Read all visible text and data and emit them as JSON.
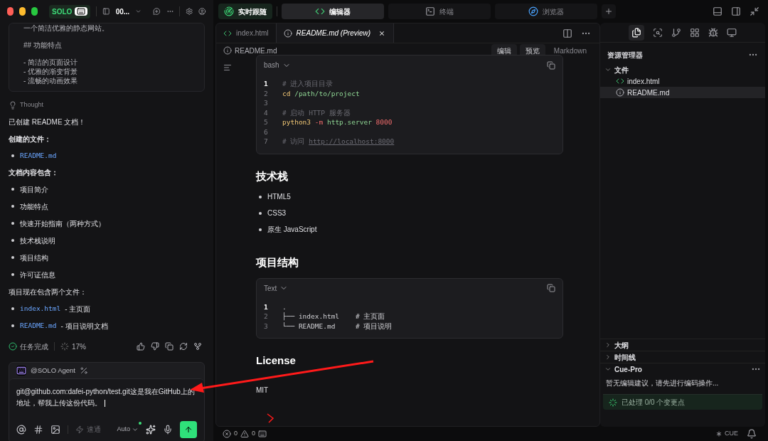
{
  "topbar": {
    "brand": "SOLO",
    "project": "00..."
  },
  "chat": {
    "snippet_groups": [
      [
        "一个简洁优雅的静态网站。"
      ],
      [
        "## 功能特点"
      ],
      [
        "- 简洁的页面设计",
        "- 优雅的渐变背景",
        "- 流畅的动画效果"
      ]
    ],
    "thought": "Thought",
    "blocks": [
      {
        "kind": "paragraph",
        "text": "已创建 README 文档！"
      },
      {
        "kind": "heading",
        "text": "创建的文件："
      },
      {
        "kind": "list",
        "items": [
          {
            "code": "README.md"
          }
        ]
      },
      {
        "kind": "heading",
        "text": "文档内容包含："
      },
      {
        "kind": "list",
        "items": [
          {
            "text": "项目简介"
          },
          {
            "text": "功能特点"
          },
          {
            "text": "快速开始指南（两种方式）"
          },
          {
            "text": "技术栈说明"
          },
          {
            "text": "项目结构"
          },
          {
            "text": "许可证信息"
          }
        ]
      },
      {
        "kind": "paragraph",
        "text": "项目现在包含两个文件："
      },
      {
        "kind": "list",
        "items": [
          {
            "code": "index.html",
            "text": "- 主页面"
          },
          {
            "code": "README.md",
            "text": "- 项目说明文档"
          }
        ]
      }
    ],
    "status": "任务完成",
    "progress": "17%",
    "input": {
      "mention": "@SOLO Agent",
      "value": "git@github.com:dafei-python/test.git这是我在GitHub上的地址，帮我上传这份代码。",
      "mode": "速通",
      "model": "Auto"
    }
  },
  "top_tabs": [
    {
      "label": "编辑器",
      "kind": "editor",
      "selected": true
    },
    {
      "label": "终端",
      "kind": "terminal",
      "selected": false
    },
    {
      "label": "浏览器",
      "kind": "browser",
      "selected": false
    }
  ],
  "follow_button": "实时跟随",
  "editor": {
    "tabs": [
      {
        "label": "index.html",
        "kind": "html",
        "selected": false
      },
      {
        "label": "README.md (Preview)",
        "kind": "info",
        "selected": true
      }
    ],
    "breadcrumb": "README.md",
    "modes": [
      "编辑",
      "预览",
      "Markdown"
    ],
    "content": [
      {
        "kind": "code",
        "lang": "bash",
        "lines": [
          {
            "num": "1",
            "active": true,
            "tokens": [
              {
                "kind": "comment",
                "text": "# 进入项目目录"
              }
            ]
          },
          {
            "num": "2",
            "active": false,
            "tokens": [
              {
                "kind": "command",
                "text": "cd"
              },
              {
                "kind": "path",
                "text": " /path/to/project"
              }
            ]
          },
          {
            "num": "3",
            "active": false
          },
          {
            "num": "4",
            "active": false,
            "tokens": [
              {
                "kind": "comment",
                "text": "# 启动 HTTP 服务器"
              }
            ]
          },
          {
            "num": "5",
            "active": false,
            "tokens": [
              {
                "kind": "command",
                "text": "python3"
              },
              {
                "kind": "flag",
                "text": " -m"
              },
              {
                "kind": "path",
                "text": " http.server"
              },
              {
                "kind": "number",
                "text": " 8000"
              }
            ]
          },
          {
            "num": "6",
            "active": false
          },
          {
            "num": "7",
            "active": false,
            "tokens": [
              {
                "kind": "comment",
                "text": "# 访问 "
              },
              {
                "kind": "link",
                "text": "http://localhost:8000"
              }
            ]
          }
        ]
      },
      {
        "kind": "heading",
        "text": "技术栈"
      },
      {
        "kind": "list",
        "items": [
          "HTML5",
          "CSS3",
          "原生 JavaScript"
        ]
      },
      {
        "kind": "heading",
        "text": "项目结构"
      },
      {
        "kind": "code",
        "lang": "Text",
        "lines": [
          {
            "num": "1",
            "active": true,
            "tokens": [
              {
                "kind": "plain",
                "text": "."
              }
            ]
          },
          {
            "num": "2",
            "active": false,
            "tokens": [
              {
                "kind": "plain",
                "text": "├── index.html    # 主页面"
              }
            ]
          },
          {
            "num": "3",
            "active": false,
            "tokens": [
              {
                "kind": "plain",
                "text": "└── README.md     # 项目说明"
              }
            ]
          }
        ]
      },
      {
        "kind": "heading",
        "text": "License"
      },
      {
        "kind": "paragraph",
        "text": "MIT"
      }
    ]
  },
  "statusbar": {
    "errors": "0",
    "warnings": "0",
    "cue": "CUE"
  },
  "explorer": {
    "title": "资源管理器",
    "tree": [
      {
        "label": "文件",
        "expanded": true,
        "children": [
          {
            "label": "index.html",
            "kind": "html",
            "selected": false
          },
          {
            "label": "README.md",
            "kind": "info",
            "selected": true
          }
        ]
      }
    ],
    "sections": [
      {
        "label": "大纲",
        "expanded": false
      },
      {
        "label": "时间线",
        "expanded": false
      },
      {
        "label": "Cue-Pro",
        "expanded": true
      }
    ],
    "cue_text": "暂无编辑建议，请先进行编码操作...",
    "cue_status": "已处理 0/0 个变更点"
  }
}
